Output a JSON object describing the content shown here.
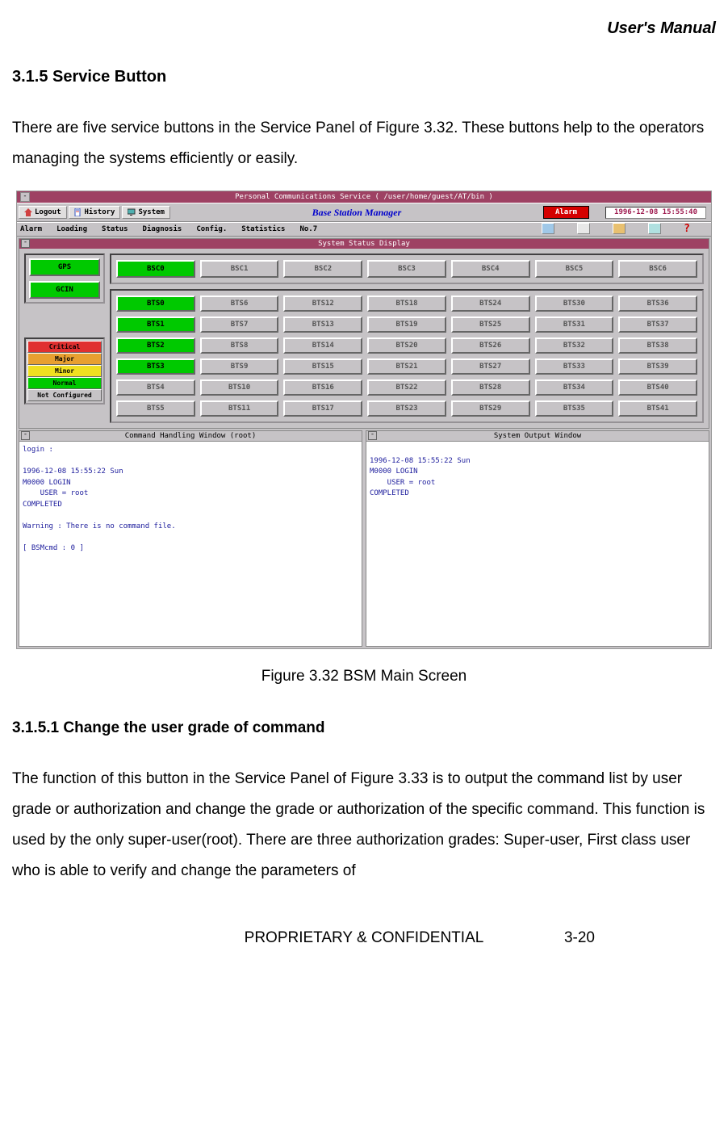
{
  "document": {
    "header_right": "User's Manual",
    "section_heading": "3.1.5 Service Button",
    "paragraph_1": "There are five service buttons in the Service Panel of Figure 3.32. These buttons help to the operators managing the systems efficiently or easily.",
    "figure_caption": "Figure 3.32 BSM Main Screen",
    "sub_heading": "3.1.5.1 Change the user grade of command",
    "paragraph_2": "The function of this button in the Service Panel of Figure 3.33 is to output the command list by user grade or authorization and change the grade or authorization of the specific command. This function is used by the only super-user(root). There are three authorization grades: Super-user, First class user who is able to verify and change the parameters of",
    "footer_center": "PROPRIETARY & CONFIDENTIAL",
    "footer_page": "3-20"
  },
  "screenshot": {
    "window_title": "Personal Communications Service ( /user/home/guest/AT/bin )",
    "toolbar": {
      "logout": "Logout",
      "history": "History",
      "system": "System",
      "app_title": "Base Station Manager",
      "alarm": "Alarm",
      "timestamp": "1996-12-08 15:55:40"
    },
    "menubar": [
      "Alarm",
      "Loading",
      "Status",
      "Diagnosis",
      "Config.",
      "Statistics",
      "No.7"
    ],
    "status_display_title": "System Status Display",
    "left_buttons": [
      "GPS",
      "GCIN"
    ],
    "legend": [
      {
        "label": "Critical",
        "class": "leg-critical"
      },
      {
        "label": "Major",
        "class": "leg-major"
      },
      {
        "label": "Minor",
        "class": "leg-minor"
      },
      {
        "label": "Normal",
        "class": "leg-normal"
      },
      {
        "label": "Not Configured",
        "class": "leg-nc"
      }
    ],
    "bsc_row": [
      {
        "label": "BSC0",
        "active": true
      },
      {
        "label": "BSC1",
        "active": false
      },
      {
        "label": "BSC2",
        "active": false
      },
      {
        "label": "BSC3",
        "active": false
      },
      {
        "label": "BSC4",
        "active": false
      },
      {
        "label": "BSC5",
        "active": false
      },
      {
        "label": "BSC6",
        "active": false
      }
    ],
    "bts_grid": [
      "BTS0",
      "BTS6",
      "BTS12",
      "BTS18",
      "BTS24",
      "BTS30",
      "BTS36",
      "BTS1",
      "BTS7",
      "BTS13",
      "BTS19",
      "BTS25",
      "BTS31",
      "BTS37",
      "BTS2",
      "BTS8",
      "BTS14",
      "BTS20",
      "BTS26",
      "BTS32",
      "BTS38",
      "BTS3",
      "BTS9",
      "BTS15",
      "BTS21",
      "BTS27",
      "BTS33",
      "BTS39",
      "BTS4",
      "BTS10",
      "BTS16",
      "BTS22",
      "BTS28",
      "BTS34",
      "BTS40",
      "BTS5",
      "BTS11",
      "BTS17",
      "BTS23",
      "BTS29",
      "BTS35",
      "BTS41"
    ],
    "bts_active": [
      "BTS0",
      "BTS1",
      "BTS2",
      "BTS3"
    ],
    "cmd_window_title": "Command Handling Window (root)",
    "cmd_window_text": "login :\n\n1996-12-08 15:55:22 Sun\nM0000 LOGIN\n    USER = root\nCOMPLETED\n\nWarning : There is no command file.\n\n[ BSMcmd : 0 ] ",
    "out_window_title": "System Output Window",
    "out_window_text": "\n1996-12-08 15:55:22 Sun\nM0000 LOGIN\n    USER = root\nCOMPLETED"
  }
}
